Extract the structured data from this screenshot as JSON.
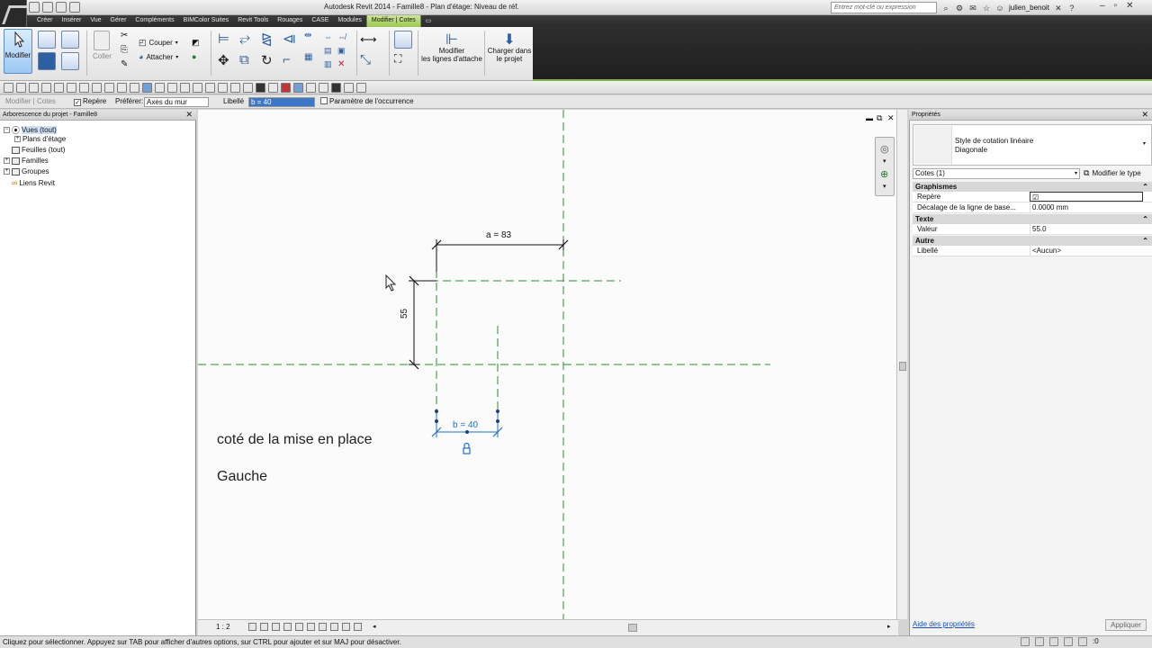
{
  "window": {
    "title": "Autodesk Revit 2014 -     Famille8 - Plan d'étage: Niveau de réf.",
    "search_placeholder": "Entrez mot-clé ou expression",
    "user": "julien_benoit"
  },
  "menu_tabs": [
    "Créer",
    "Insérer",
    "Vue",
    "Gérer",
    "Compléments",
    "BIMColor Suites",
    "Revit Tools",
    "Rouages",
    "CASE",
    "Modules",
    "Modifier | Cotes"
  ],
  "ribbon": {
    "modify_label": "Modifier",
    "paste_label": "Coller",
    "cut_label": "Couper",
    "attach_label": "Attacher",
    "modify_witness_label": "Modifier\nles lignes d'attache",
    "load_label": "Charger dans\nle projet"
  },
  "options_bar": {
    "context": "Modifier | Cotes",
    "repere_label": "Repère",
    "prefer_label": "Préférer:",
    "prefer_value": "Axes du mur",
    "libelle_label": "Libellé",
    "libelle_value": "b = 40",
    "occurrence_label": "Paramètre de l'occurrence"
  },
  "project_browser": {
    "title": "Arborescence du projet - Famille8",
    "items": [
      {
        "label": "Vues (tout)",
        "expander": "−"
      },
      {
        "label": "Plans d'étage",
        "expander": "+"
      },
      {
        "label": "Feuilles (tout)",
        "expander": ""
      },
      {
        "label": "Familles",
        "expander": "+"
      },
      {
        "label": "Groupes",
        "expander": "+"
      },
      {
        "label": "Liens Revit",
        "expander": ""
      }
    ]
  },
  "canvas": {
    "dim_a": "a = 83",
    "dim_55": "55",
    "dim_b": "b = 40",
    "note_1": "coté de la mise en place",
    "note_2": "Gauche",
    "scale": "1 : 2"
  },
  "properties": {
    "title": "Propriétés",
    "type_family": "Style de cotation linéaire",
    "type_name": "Diagonale",
    "selector": "Cotes (1)",
    "edit_type": "Modifier le type",
    "categories": [
      {
        "name": "Graphismes",
        "rows": [
          {
            "key": "Repère",
            "value": "☑"
          },
          {
            "key": "Décalage de la ligne de base...",
            "value": "0.0000 mm"
          }
        ]
      },
      {
        "name": "Texte",
        "rows": [
          {
            "key": "Valeur",
            "value": "55.0"
          }
        ]
      },
      {
        "name": "Autre",
        "rows": [
          {
            "key": "Libellé",
            "value": "<Aucun>"
          }
        ]
      }
    ],
    "help_link": "Aide des propriétés",
    "apply": "Appliquer"
  },
  "status": {
    "text": "Cliquez pour sélectionner. Appuyez sur TAB pour afficher d'autres options, sur CTRL pour ajouter et sur MAJ pour désactiver.",
    "filter_count": ":0"
  },
  "colors": {
    "ref_plane": "#2e8b2e",
    "selection": "#1e6fc8",
    "active_tab": "#9bc94f"
  }
}
